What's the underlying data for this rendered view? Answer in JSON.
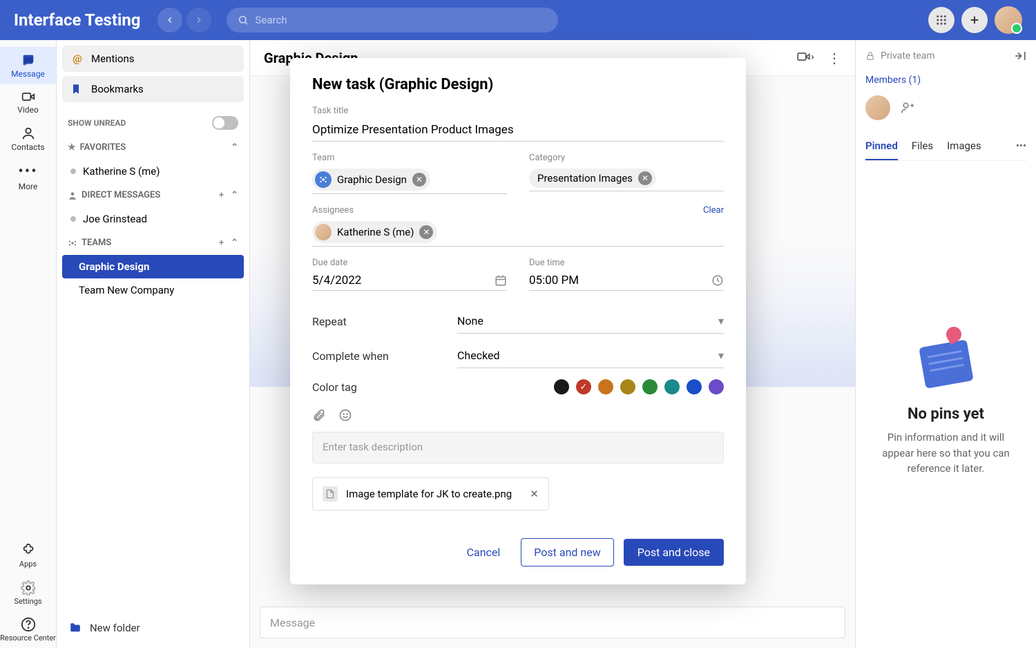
{
  "app": {
    "title": "Interface Testing",
    "search_placeholder": "Search"
  },
  "rail": {
    "items": [
      {
        "label": "Message"
      },
      {
        "label": "Video"
      },
      {
        "label": "Contacts"
      },
      {
        "label": "More"
      }
    ],
    "bottom": [
      {
        "label": "Apps"
      },
      {
        "label": "Settings"
      },
      {
        "label": "Resource Center"
      }
    ]
  },
  "sidebar": {
    "mentions": "Mentions",
    "bookmarks": "Bookmarks",
    "show_unread": "SHOW UNREAD",
    "favorites": "FAVORITES",
    "favorite_items": [
      {
        "label": "Katherine S (me)"
      }
    ],
    "direct": "DIRECT MESSAGES",
    "direct_items": [
      {
        "label": "Joe Grinstead"
      }
    ],
    "teams": "TEAMS",
    "team_items": [
      {
        "label": "Graphic Design"
      },
      {
        "label": "Team New Company"
      }
    ],
    "new_folder": "New folder"
  },
  "content": {
    "title": "Graphic Design",
    "message_placeholder": "Message"
  },
  "rpanel": {
    "private": "Private team",
    "members": "Members (1)",
    "tabs": [
      "Pinned",
      "Files",
      "Images"
    ],
    "empty_title": "No pins yet",
    "empty_body": "Pin information and it will appear here so that you can reference it later."
  },
  "modal": {
    "title": "New task (Graphic Design)",
    "labels": {
      "task_title": "Task title",
      "team": "Team",
      "category": "Category",
      "assignees": "Assignees",
      "clear": "Clear",
      "due_date": "Due date",
      "due_time": "Due time",
      "repeat": "Repeat",
      "complete_when": "Complete when",
      "color_tag": "Color tag",
      "desc_placeholder": "Enter task description"
    },
    "values": {
      "task_title": "Optimize Presentation Product Images",
      "team_chip": "Graphic Design",
      "category_chip": "Presentation Images",
      "assignee_chip": "Katherine S (me)",
      "due_date": "5/4/2022",
      "due_time": "05:00 PM",
      "repeat": "None",
      "complete_when": "Checked"
    },
    "colors": [
      "#1a1a1a",
      "#c0392b",
      "#c9731a",
      "#a8861a",
      "#2a8a3a",
      "#1a8a8a",
      "#1a4fc9",
      "#6a4bc9"
    ],
    "selected_color_index": 1,
    "attachment": "Image template for JK to create.png",
    "buttons": {
      "cancel": "Cancel",
      "post_new": "Post and new",
      "post_close": "Post and close"
    }
  }
}
